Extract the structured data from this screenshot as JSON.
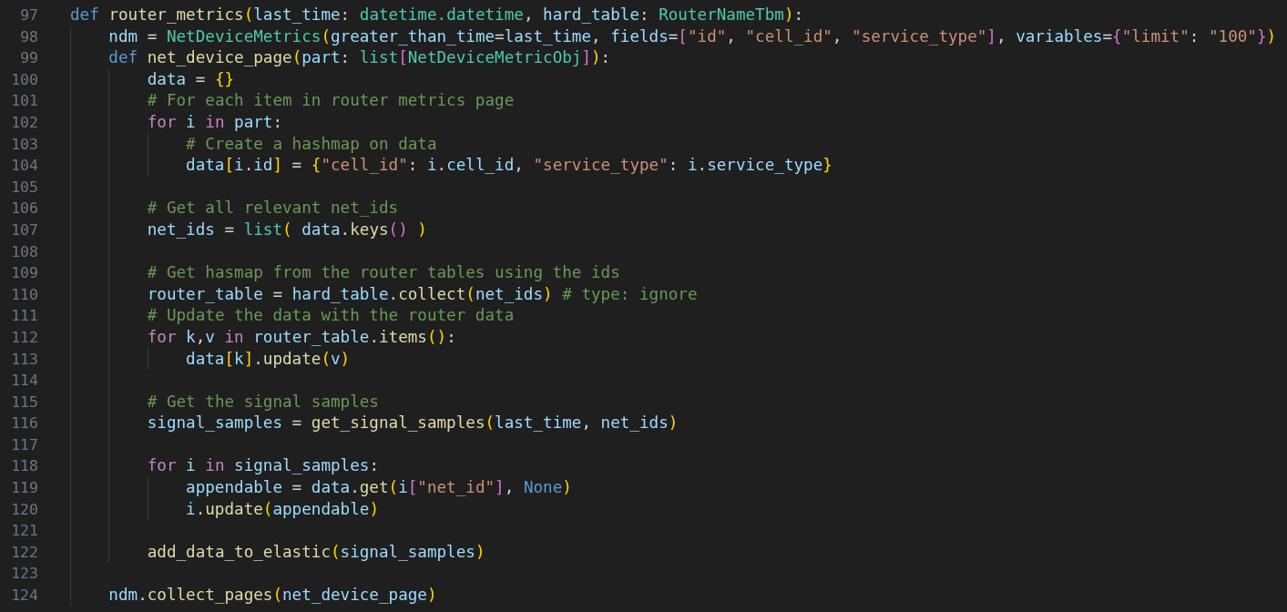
{
  "editor": {
    "lines": [
      {
        "number": "97",
        "tokens": [
          {
            "text": "def ",
            "kind": "keyword"
          },
          {
            "text": "router_metrics",
            "kind": "function"
          },
          {
            "text": "(",
            "kind": "bracket1"
          },
          {
            "text": "last_time",
            "kind": "variable"
          },
          {
            "text": ": ",
            "kind": "plain"
          },
          {
            "text": "datetime.datetime",
            "kind": "type"
          },
          {
            "text": ", ",
            "kind": "plain"
          },
          {
            "text": "hard_table",
            "kind": "variable"
          },
          {
            "text": ": ",
            "kind": "plain"
          },
          {
            "text": "RouterNameTbm",
            "kind": "type"
          },
          {
            "text": ")",
            "kind": "bracket1"
          },
          {
            "text": ":",
            "kind": "plain"
          }
        ],
        "children": [
          {
            "number": "98",
            "tokens": [
              {
                "text": "ndm",
                "kind": "variable"
              },
              {
                "text": " = ",
                "kind": "plain"
              },
              {
                "text": "NetDeviceMetrics",
                "kind": "type"
              },
              {
                "text": "(",
                "kind": "bracket1"
              },
              {
                "text": "greater_than_time",
                "kind": "variable"
              },
              {
                "text": "=",
                "kind": "plain"
              },
              {
                "text": "last_time",
                "kind": "variable"
              },
              {
                "text": ", ",
                "kind": "plain"
              },
              {
                "text": "fields",
                "kind": "variable"
              },
              {
                "text": "=",
                "kind": "plain"
              },
              {
                "text": "[",
                "kind": "bracket2"
              },
              {
                "text": "\"id\"",
                "kind": "string"
              },
              {
                "text": ", ",
                "kind": "plain"
              },
              {
                "text": "\"cell_id\"",
                "kind": "string"
              },
              {
                "text": ", ",
                "kind": "plain"
              },
              {
                "text": "\"service_type\"",
                "kind": "string"
              },
              {
                "text": "]",
                "kind": "bracket2"
              },
              {
                "text": ", ",
                "kind": "plain"
              },
              {
                "text": "variables",
                "kind": "variable"
              },
              {
                "text": "=",
                "kind": "plain"
              },
              {
                "text": "{",
                "kind": "bracket2"
              },
              {
                "text": "\"limit\"",
                "kind": "string"
              },
              {
                "text": ": ",
                "kind": "plain"
              },
              {
                "text": "\"100\"",
                "kind": "string"
              },
              {
                "text": "}",
                "kind": "bracket2"
              },
              {
                "text": ")",
                "kind": "bracket1"
              }
            ]
          },
          {
            "number": "99",
            "tokens": [
              {
                "text": "def ",
                "kind": "keyword"
              },
              {
                "text": "net_device_page",
                "kind": "function"
              },
              {
                "text": "(",
                "kind": "bracket1"
              },
              {
                "text": "part",
                "kind": "variable"
              },
              {
                "text": ": ",
                "kind": "plain"
              },
              {
                "text": "list",
                "kind": "type"
              },
              {
                "text": "[",
                "kind": "bracket2"
              },
              {
                "text": "NetDeviceMetricObj",
                "kind": "type"
              },
              {
                "text": "]",
                "kind": "bracket2"
              },
              {
                "text": ")",
                "kind": "bracket1"
              },
              {
                "text": ":",
                "kind": "plain"
              }
            ],
            "children": [
              {
                "number": "100",
                "tokens": [
                  {
                    "text": "data",
                    "kind": "variable"
                  },
                  {
                    "text": " = ",
                    "kind": "plain"
                  },
                  {
                    "text": "{}",
                    "kind": "bracket1"
                  }
                ]
              },
              {
                "number": "101",
                "tokens": [
                  {
                    "text": "# For each item in router metrics page",
                    "kind": "comment"
                  }
                ]
              },
              {
                "number": "102",
                "tokens": [
                  {
                    "text": "for ",
                    "kind": "control"
                  },
                  {
                    "text": "i ",
                    "kind": "variable"
                  },
                  {
                    "text": "in ",
                    "kind": "control"
                  },
                  {
                    "text": "part",
                    "kind": "variable"
                  },
                  {
                    "text": ":",
                    "kind": "plain"
                  }
                ],
                "children": [
                  {
                    "number": "103",
                    "tokens": [
                      {
                        "text": "# Create a hashmap on data",
                        "kind": "comment"
                      }
                    ]
                  },
                  {
                    "number": "104",
                    "tokens": [
                      {
                        "text": "data",
                        "kind": "variable"
                      },
                      {
                        "text": "[",
                        "kind": "bracket1"
                      },
                      {
                        "text": "i",
                        "kind": "variable"
                      },
                      {
                        "text": ".",
                        "kind": "plain"
                      },
                      {
                        "text": "id",
                        "kind": "variable"
                      },
                      {
                        "text": "]",
                        "kind": "bracket1"
                      },
                      {
                        "text": " = ",
                        "kind": "plain"
                      },
                      {
                        "text": "{",
                        "kind": "bracket1"
                      },
                      {
                        "text": "\"cell_id\"",
                        "kind": "string"
                      },
                      {
                        "text": ": ",
                        "kind": "plain"
                      },
                      {
                        "text": "i",
                        "kind": "variable"
                      },
                      {
                        "text": ".",
                        "kind": "plain"
                      },
                      {
                        "text": "cell_id",
                        "kind": "variable"
                      },
                      {
                        "text": ", ",
                        "kind": "plain"
                      },
                      {
                        "text": "\"service_type\"",
                        "kind": "string"
                      },
                      {
                        "text": ": ",
                        "kind": "plain"
                      },
                      {
                        "text": "i",
                        "kind": "variable"
                      },
                      {
                        "text": ".",
                        "kind": "plain"
                      },
                      {
                        "text": "service_type",
                        "kind": "variable"
                      },
                      {
                        "text": "}",
                        "kind": "bracket1"
                      }
                    ]
                  }
                ]
              },
              {
                "number": "105"
              },
              {
                "number": "106",
                "tokens": [
                  {
                    "text": "# Get all relevant net_ids",
                    "kind": "comment"
                  }
                ]
              },
              {
                "number": "107",
                "tokens": [
                  {
                    "text": "net_ids",
                    "kind": "variable"
                  },
                  {
                    "text": " = ",
                    "kind": "plain"
                  },
                  {
                    "text": "list",
                    "kind": "type"
                  },
                  {
                    "text": "( ",
                    "kind": "bracket1"
                  },
                  {
                    "text": "data",
                    "kind": "variable"
                  },
                  {
                    "text": ".",
                    "kind": "plain"
                  },
                  {
                    "text": "keys",
                    "kind": "function"
                  },
                  {
                    "text": "()",
                    "kind": "bracket2"
                  },
                  {
                    "text": " )",
                    "kind": "bracket1"
                  }
                ]
              },
              {
                "number": "108"
              },
              {
                "number": "109",
                "tokens": [
                  {
                    "text": "# Get hasmap from the router tables using the ids",
                    "kind": "comment"
                  }
                ]
              },
              {
                "number": "110",
                "tokens": [
                  {
                    "text": "router_table",
                    "kind": "variable"
                  },
                  {
                    "text": " = ",
                    "kind": "plain"
                  },
                  {
                    "text": "hard_table",
                    "kind": "variable"
                  },
                  {
                    "text": ".",
                    "kind": "plain"
                  },
                  {
                    "text": "collect",
                    "kind": "function"
                  },
                  {
                    "text": "(",
                    "kind": "bracket1"
                  },
                  {
                    "text": "net_ids",
                    "kind": "variable"
                  },
                  {
                    "text": ") ",
                    "kind": "bracket1"
                  },
                  {
                    "text": "# type: ignore",
                    "kind": "comment"
                  }
                ]
              },
              {
                "number": "111",
                "tokens": [
                  {
                    "text": "# Update the data with the router data",
                    "kind": "comment"
                  }
                ]
              },
              {
                "number": "112",
                "tokens": [
                  {
                    "text": "for ",
                    "kind": "control"
                  },
                  {
                    "text": "k",
                    "kind": "variable"
                  },
                  {
                    "text": ",",
                    "kind": "plain"
                  },
                  {
                    "text": "v ",
                    "kind": "variable"
                  },
                  {
                    "text": "in ",
                    "kind": "control"
                  },
                  {
                    "text": "router_table",
                    "kind": "variable"
                  },
                  {
                    "text": ".",
                    "kind": "plain"
                  },
                  {
                    "text": "items",
                    "kind": "function"
                  },
                  {
                    "text": "()",
                    "kind": "bracket1"
                  },
                  {
                    "text": ":",
                    "kind": "plain"
                  }
                ],
                "children": [
                  {
                    "number": "113",
                    "tokens": [
                      {
                        "text": "data",
                        "kind": "variable"
                      },
                      {
                        "text": "[",
                        "kind": "bracket1"
                      },
                      {
                        "text": "k",
                        "kind": "variable"
                      },
                      {
                        "text": "]",
                        "kind": "bracket1"
                      },
                      {
                        "text": ".",
                        "kind": "plain"
                      },
                      {
                        "text": "update",
                        "kind": "function"
                      },
                      {
                        "text": "(",
                        "kind": "bracket1"
                      },
                      {
                        "text": "v",
                        "kind": "variable"
                      },
                      {
                        "text": ")",
                        "kind": "bracket1"
                      }
                    ]
                  }
                ]
              },
              {
                "number": "114"
              },
              {
                "number": "115",
                "tokens": [
                  {
                    "text": "# Get the signal samples",
                    "kind": "comment"
                  }
                ]
              },
              {
                "number": "116",
                "tokens": [
                  {
                    "text": "signal_samples",
                    "kind": "variable"
                  },
                  {
                    "text": " = ",
                    "kind": "plain"
                  },
                  {
                    "text": "get_signal_samples",
                    "kind": "function"
                  },
                  {
                    "text": "(",
                    "kind": "bracket1"
                  },
                  {
                    "text": "last_time",
                    "kind": "variable"
                  },
                  {
                    "text": ", ",
                    "kind": "plain"
                  },
                  {
                    "text": "net_ids",
                    "kind": "variable"
                  },
                  {
                    "text": ")",
                    "kind": "bracket1"
                  }
                ]
              },
              {
                "number": "117"
              },
              {
                "number": "118",
                "tokens": [
                  {
                    "text": "for ",
                    "kind": "control"
                  },
                  {
                    "text": "i ",
                    "kind": "variable"
                  },
                  {
                    "text": "in ",
                    "kind": "control"
                  },
                  {
                    "text": "signal_samples",
                    "kind": "variable"
                  },
                  {
                    "text": ":",
                    "kind": "plain"
                  }
                ],
                "children": [
                  {
                    "number": "119",
                    "tokens": [
                      {
                        "text": "appendable",
                        "kind": "variable"
                      },
                      {
                        "text": " = ",
                        "kind": "plain"
                      },
                      {
                        "text": "data",
                        "kind": "variable"
                      },
                      {
                        "text": ".",
                        "kind": "plain"
                      },
                      {
                        "text": "get",
                        "kind": "function"
                      },
                      {
                        "text": "(",
                        "kind": "bracket1"
                      },
                      {
                        "text": "i",
                        "kind": "variable"
                      },
                      {
                        "text": "[",
                        "kind": "bracket2"
                      },
                      {
                        "text": "\"net_id\"",
                        "kind": "string"
                      },
                      {
                        "text": "]",
                        "kind": "bracket2"
                      },
                      {
                        "text": ", ",
                        "kind": "plain"
                      },
                      {
                        "text": "None",
                        "kind": "constant"
                      },
                      {
                        "text": ")",
                        "kind": "bracket1"
                      }
                    ]
                  },
                  {
                    "number": "120",
                    "tokens": [
                      {
                        "text": "i",
                        "kind": "variable"
                      },
                      {
                        "text": ".",
                        "kind": "plain"
                      },
                      {
                        "text": "update",
                        "kind": "function"
                      },
                      {
                        "text": "(",
                        "kind": "bracket1"
                      },
                      {
                        "text": "appendable",
                        "kind": "variable"
                      },
                      {
                        "text": ")",
                        "kind": "bracket1"
                      }
                    ]
                  }
                ]
              },
              {
                "number": "121"
              },
              {
                "number": "122",
                "tokens": [
                  {
                    "text": "add_data_to_elastic",
                    "kind": "function"
                  },
                  {
                    "text": "(",
                    "kind": "bracket1"
                  },
                  {
                    "text": "signal_samples",
                    "kind": "variable"
                  },
                  {
                    "text": ")",
                    "kind": "bracket1"
                  }
                ]
              }
            ]
          },
          {
            "number": "123"
          },
          {
            "number": "124",
            "tokens": [
              {
                "text": "ndm",
                "kind": "variable"
              },
              {
                "text": ".",
                "kind": "plain"
              },
              {
                "text": "collect_pages",
                "kind": "function"
              },
              {
                "text": "(",
                "kind": "bracket1"
              },
              {
                "text": "net_device_page",
                "kind": "variable"
              },
              {
                "text": ")",
                "kind": "bracket1"
              }
            ]
          }
        ]
      }
    ]
  }
}
